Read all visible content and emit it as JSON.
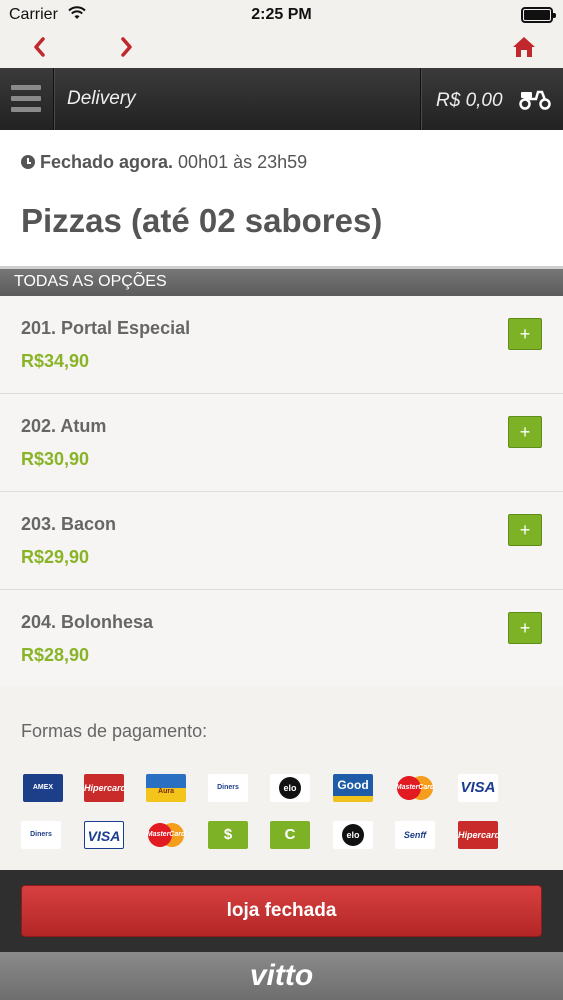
{
  "status_bar": {
    "carrier": "Carrier",
    "time": "2:25 PM"
  },
  "icons": {
    "wifi": "wifi-icon",
    "battery": "battery-icon",
    "back": "chevron-left-icon",
    "forward": "chevron-right-icon",
    "home": "home-icon",
    "menu": "hamburger-menu-icon",
    "delivery": "scooter-icon",
    "clock": "clock-icon"
  },
  "header": {
    "title": "Delivery",
    "cart_total": "R$ 0,00"
  },
  "store": {
    "status": "Fechado agora.",
    "hours": "00h01 às 23h59",
    "category_title": "Pizzas (até 02 sabores)"
  },
  "section_label": "TODAS AS OPÇÕES",
  "items": [
    {
      "name": "201. Portal Especial",
      "price": "R$34,90",
      "add_label": "+"
    },
    {
      "name": "202. Atum",
      "price": "R$30,90",
      "add_label": "+"
    },
    {
      "name": "203. Bacon",
      "price": "R$29,90",
      "add_label": "+"
    },
    {
      "name": "204. Bolonhesa",
      "price": "R$28,90",
      "add_label": "+"
    }
  ],
  "payments": {
    "label": "Formas de pagamento:",
    "methods": [
      {
        "name": "american-express",
        "text": "AMEX"
      },
      {
        "name": "hipercard",
        "text": "Hipercard"
      },
      {
        "name": "aura",
        "text": "Aura"
      },
      {
        "name": "diners-club",
        "text": "Diners"
      },
      {
        "name": "elo",
        "text": "elo"
      },
      {
        "name": "good-card",
        "text": "Good"
      },
      {
        "name": "mastercard",
        "text": "MasterCard"
      },
      {
        "name": "visa",
        "text": "VISA"
      },
      {
        "name": "diners-club-2",
        "text": "Diners"
      },
      {
        "name": "visa-electron",
        "text": "VISA"
      },
      {
        "name": "mastercard-2",
        "text": "MasterCard"
      },
      {
        "name": "cash",
        "text": "$"
      },
      {
        "name": "check",
        "text": "C"
      },
      {
        "name": "elo-2",
        "text": "elo"
      },
      {
        "name": "sodexo",
        "text": "Senff"
      },
      {
        "name": "hipercard-2",
        "text": "Hipercard"
      }
    ]
  },
  "footer": {
    "button_label": "loja fechada"
  },
  "brand": {
    "logo_text": "vitto"
  },
  "colors": {
    "accent_green": "#7db227",
    "price_green": "#8ab428",
    "closed_red": "#c62f2f",
    "nav_red": "#c0282b"
  }
}
